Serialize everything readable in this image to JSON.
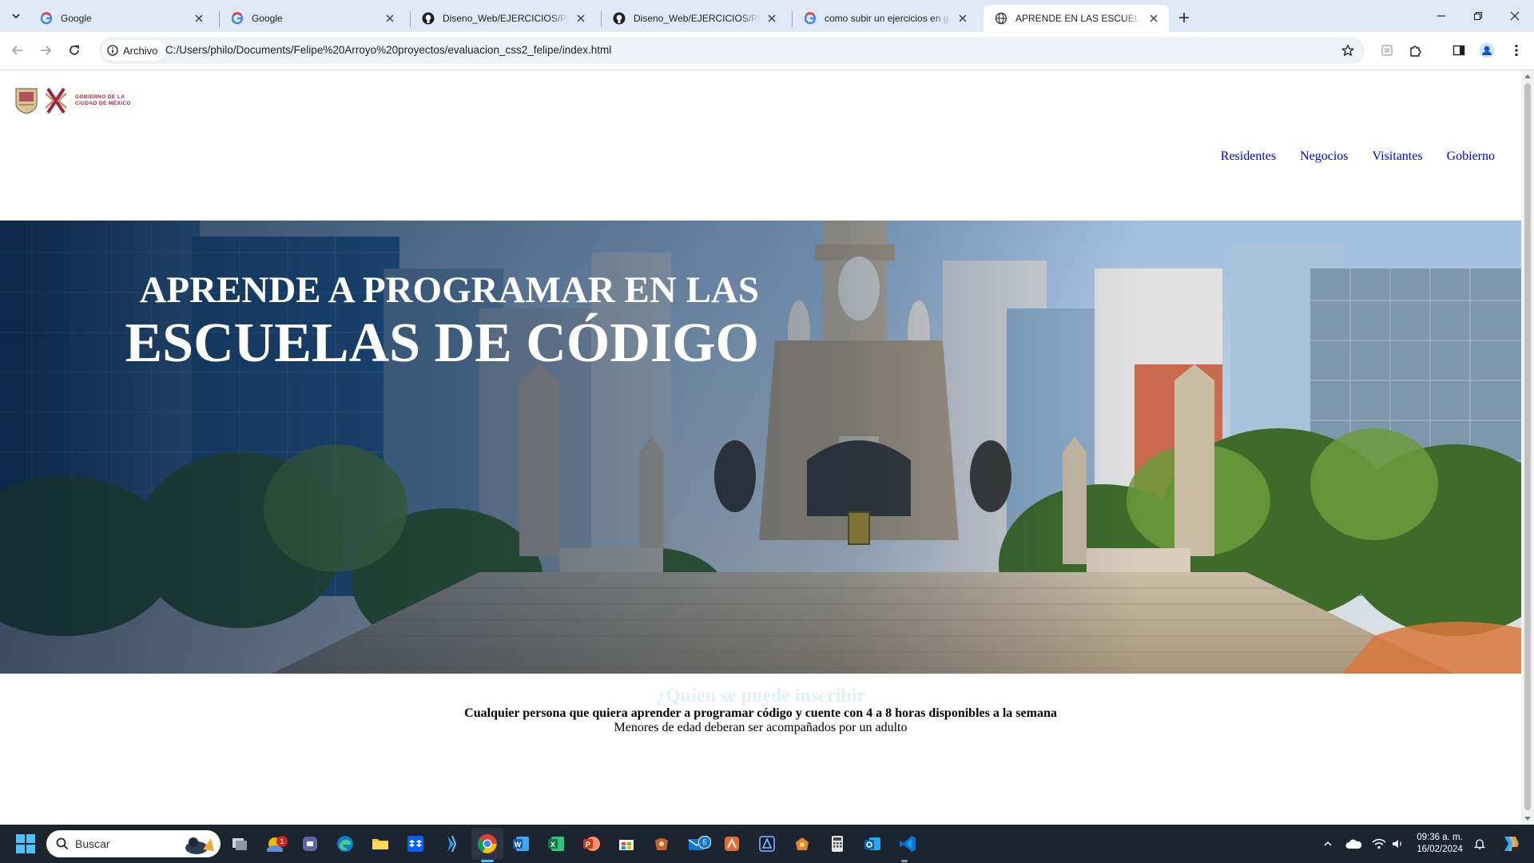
{
  "browser": {
    "tabs": [
      {
        "title": "Google",
        "favicon": "google-g-icon"
      },
      {
        "title": "Google",
        "favicon": "google-g-icon"
      },
      {
        "title": "Diseno_Web/EJERCICIOS/PROYECTOS",
        "favicon": "github-icon"
      },
      {
        "title": "Diseno_Web/EJERCICIOS/PROYECTOS",
        "favicon": "github-icon"
      },
      {
        "title": "como subir un ejercicios en github",
        "favicon": "google-g-icon"
      },
      {
        "title": "APRENDE EN LAS ESCUELAS DE CÓDIGO",
        "favicon": "globe-icon",
        "active": true
      }
    ],
    "site_chip": "Archivo",
    "url": "C:/Users/philo/Documents/Felipe%20Arroyo%20proyectos/evaluacion_css2_felipe/index.html"
  },
  "site": {
    "logo_text_line1": "GOBIERNO DE LA",
    "logo_text_line2": "CIUDAD DE MÉXICO",
    "nav": [
      "Residentes",
      "Negocios",
      "Visitantes",
      "Gobierno"
    ],
    "hero": {
      "title_line1": "APRENDE A PROGRAMAR EN LAS",
      "title_line2": "ESCUELAS DE CÓDIGO"
    },
    "content": {
      "heading": "¿Quien se puede inscribir",
      "line1": "Cualquier persona que quiera aprender a programar código y cuente con 4 a 8 horas disponibles a la semana",
      "line2": "Menores de edad deberan ser acompañados por un adulto"
    }
  },
  "taskbar": {
    "search_placeholder": "Buscar",
    "badges": {
      "notifications": "1",
      "mail": "5"
    },
    "time": "09:36 a. m.",
    "date": "16/02/2024"
  },
  "colors": {
    "tabbar_bg": "#dfe8f7",
    "link_blue": "#0000ee",
    "logo_maroon": "#9f2241",
    "taskbar_bg": "#1c2430"
  }
}
